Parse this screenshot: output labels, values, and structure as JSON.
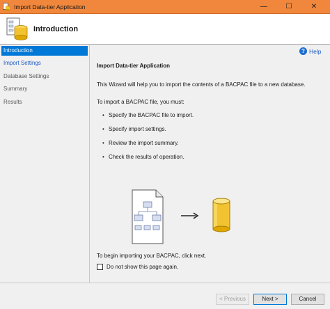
{
  "window": {
    "title": "Import Data-tier Application",
    "minimize": "—",
    "maximize": "☐",
    "close": "✕"
  },
  "header": {
    "title": "Introduction"
  },
  "sidebar": {
    "items": [
      {
        "label": "Introduction",
        "state": "selected"
      },
      {
        "label": "Import Settings",
        "state": "link"
      },
      {
        "label": "Database Settings",
        "state": "disabled"
      },
      {
        "label": "Summary",
        "state": "disabled"
      },
      {
        "label": "Results",
        "state": "disabled"
      }
    ]
  },
  "help": {
    "icon": "?",
    "label": "Help"
  },
  "content": {
    "heading": "Import Data-tier Application",
    "intro": "This Wizard will help you to import the contents of a BACPAC file to a new database.",
    "todo_lead": "To import a BACPAC file, you must:",
    "bullet": "•",
    "steps": [
      "Specify the BACPAC file to import.",
      "Specify import settings.",
      "Review the import summary.",
      "Check the results of operation."
    ],
    "closing": "To begin importing your BACPAC, click next.",
    "checkbox_label": "Do not show this page again.",
    "checkbox_checked": false
  },
  "footer": {
    "previous": "< Previous",
    "next": "Next >",
    "cancel": "Cancel"
  },
  "colors": {
    "titlebar": "#f0873c",
    "selection": "#0078d7",
    "link": "#1c5bc4",
    "database": "#f2c230"
  },
  "icons": {
    "app": "database-app-icon",
    "header": "database-wizard-icon",
    "help": "help-icon",
    "file": "bacpac-file-icon",
    "arrow": "arrow-right-icon",
    "database": "database-icon"
  }
}
